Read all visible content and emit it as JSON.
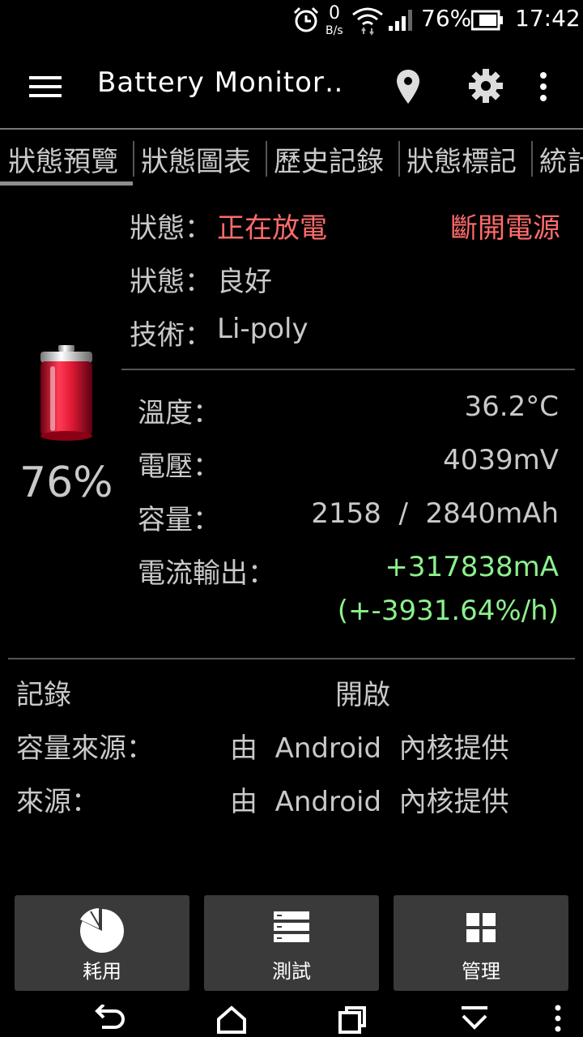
{
  "status_bar": {
    "data_speed": "0",
    "data_unit": "B/s",
    "battery_percent": "76%",
    "time": "17:42"
  },
  "app_bar": {
    "title": "Battery Monitor‥"
  },
  "tabs": [
    {
      "label": "狀態預覽",
      "selected": true
    },
    {
      "label": "狀態圖表"
    },
    {
      "label": "歷史記錄"
    },
    {
      "label": "狀態標記"
    },
    {
      "label": "統計"
    }
  ],
  "battery": {
    "percent": "76%",
    "level": 0.76
  },
  "info": {
    "status_label": "狀態：",
    "status_value": "正在放電",
    "power_state": "斷開電源",
    "health_label": "狀態：",
    "health_value": "良好",
    "tech_label": "技術：",
    "tech_value": "Li-poly"
  },
  "metrics": {
    "temp_label": "溫度：",
    "temp_value": "36.2°C",
    "voltage_label": "電壓：",
    "voltage_value": "4039mV",
    "capacity_label": "容量：",
    "capacity_value": "2158  /  2840mAh",
    "current_label": "電流輸出：",
    "current_value": "+317838mA",
    "current_rate": "(+-3931.64%/h)"
  },
  "details": {
    "log_label": "記錄",
    "log_value": "開啟",
    "cap_source_label": "容量來源：",
    "cap_source_value": "由  Android  內核提供",
    "source_label": "來源：",
    "source_value": "由  Android  內核提供"
  },
  "buttons": {
    "usage": "耗用",
    "test": "測試",
    "manage": "管理"
  },
  "colors": {
    "discharge_red": "#ff6b6b",
    "current_green": "#8cf08c",
    "button_bg": "#3a3a3a"
  }
}
